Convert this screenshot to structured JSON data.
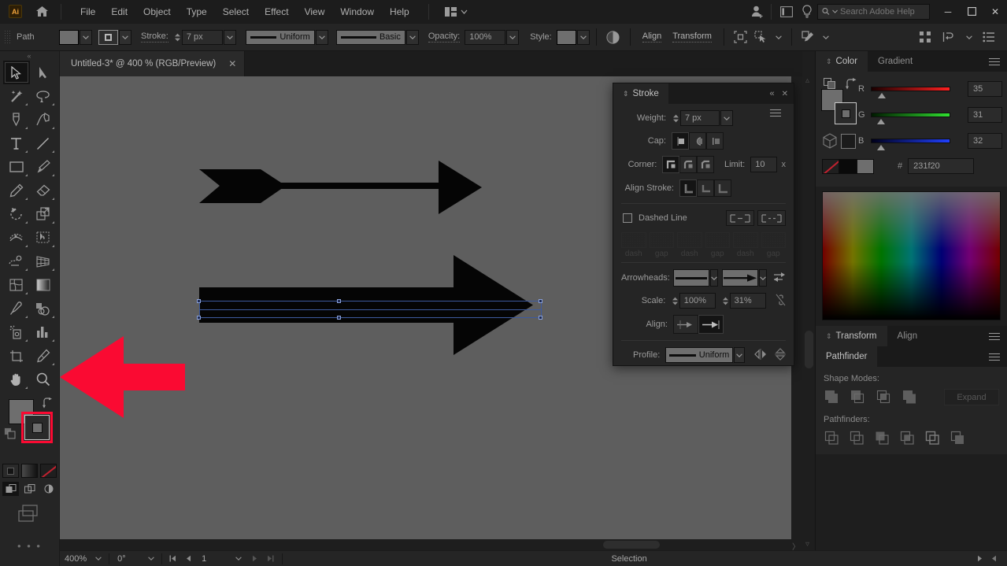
{
  "app": {
    "name": "Adobe Illustrator",
    "logo_text": "Ai",
    "home_icon": "home-icon"
  },
  "menubar": {
    "items": [
      "File",
      "Edit",
      "Object",
      "Type",
      "Select",
      "Effect",
      "View",
      "Window",
      "Help"
    ],
    "arrange_icon": "arrange-documents-icon",
    "account_icon": "account-add-icon",
    "workspace_icon": "workspace-switcher-icon",
    "tips_icon": "lightbulb-icon",
    "search": {
      "placeholder": "Search Adobe Help",
      "value": "",
      "icon": "search-icon"
    },
    "window_controls": {
      "minimize": "─",
      "maximize": "❐",
      "close": "✕"
    }
  },
  "controlbar": {
    "object_label": "Path",
    "fill_swatch": "#6e6e6e",
    "stroke_swatch_label": "stroke-swatch",
    "stroke_label": "Stroke:",
    "stroke_weight": "7 px",
    "profile_label": "Uniform",
    "brush_label": "Basic",
    "opacity_label": "Opacity:",
    "opacity_value": "100%",
    "style_label": "Style:",
    "align_label": "Align",
    "transform_label": "Transform",
    "icons": [
      "opacity-circle-icon",
      "isolate-selection-icon",
      "select-similar-icon",
      "edit-toolbar-icon",
      "arrange-icon",
      "recolor-icon",
      "document-setup-icon"
    ]
  },
  "document_tab": {
    "title": "Untitled-3* @ 400 % (RGB/Preview)",
    "close": "✕"
  },
  "toolbar": {
    "grip": "«",
    "tools": [
      {
        "name": "selection-tool",
        "active": true
      },
      {
        "name": "direct-selection-tool",
        "active": false
      },
      {
        "name": "magic-wand-tool",
        "active": false
      },
      {
        "name": "lasso-tool",
        "active": false
      },
      {
        "name": "pen-tool",
        "active": false
      },
      {
        "name": "curvature-tool",
        "active": false
      },
      {
        "name": "type-tool",
        "active": false
      },
      {
        "name": "line-segment-tool",
        "active": false
      },
      {
        "name": "rectangle-tool",
        "active": false
      },
      {
        "name": "paintbrush-tool",
        "active": false
      },
      {
        "name": "pencil-tool",
        "active": false
      },
      {
        "name": "eraser-tool",
        "active": false
      },
      {
        "name": "rotate-tool",
        "active": false
      },
      {
        "name": "scale-tool",
        "active": false
      },
      {
        "name": "width-tool",
        "active": false
      },
      {
        "name": "free-transform-tool",
        "active": false
      },
      {
        "name": "shape-builder-tool",
        "active": false
      },
      {
        "name": "perspective-grid-tool",
        "active": false
      },
      {
        "name": "mesh-tool",
        "active": false
      },
      {
        "name": "gradient-tool",
        "active": false
      },
      {
        "name": "eyedropper-tool",
        "active": false
      },
      {
        "name": "blend-tool",
        "active": false
      },
      {
        "name": "symbol-sprayer-tool",
        "active": false
      },
      {
        "name": "column-graph-tool",
        "active": false
      },
      {
        "name": "artboard-tool",
        "active": false
      },
      {
        "name": "slice-tool",
        "active": false
      },
      {
        "name": "hand-tool",
        "active": false
      },
      {
        "name": "zoom-tool",
        "active": false
      }
    ],
    "fill_color": "#6e6e6e",
    "stroke_color": "#6e6e6e",
    "highlight_color": "#fa0a32",
    "draw_modes": [
      "draw-normal-icon",
      "draw-behind-icon",
      "draw-inside-icon"
    ],
    "screen_modes": [
      "color-fill-icon",
      "gradient-fill-icon",
      "none-fill-icon"
    ],
    "more_dots": "• • •"
  },
  "stroke_panel": {
    "title": "Stroke",
    "collapse_icon": "⇕",
    "menu_icon": "panel-menu-icon",
    "collapse_btn": "«",
    "close_btn": "✕",
    "weight_label": "Weight:",
    "weight_value": "7 px",
    "cap_label": "Cap:",
    "cap_options": [
      "butt-cap",
      "round-cap",
      "projecting-cap"
    ],
    "cap_selected": 0,
    "corner_label": "Corner:",
    "corner_options": [
      "miter-join",
      "round-join",
      "bevel-join"
    ],
    "corner_selected": 0,
    "limit_label": "Limit:",
    "limit_value": "10",
    "limit_unit": "x",
    "align_stroke_label": "Align Stroke:",
    "align_stroke_options": [
      "align-center",
      "align-inside",
      "align-outside"
    ],
    "align_stroke_selected": 0,
    "dashed_line_label": "Dashed Line",
    "dashed_checked": false,
    "dash_labels": [
      "dash",
      "gap",
      "dash",
      "gap",
      "dash",
      "gap"
    ],
    "dash_values": [
      "",
      "",
      "",
      "",
      "",
      ""
    ],
    "arrowheads_label": "Arrowheads:",
    "arrowhead_start": "none",
    "arrowhead_end": "arrow",
    "swap_icon": "swap-arrowheads-icon",
    "scale_label": "Scale:",
    "scale_start": "100%",
    "scale_end": "31%",
    "link_icon": "link-broken-icon",
    "align_label": "Align:",
    "align_options": [
      "extend-beyond-end",
      "place-at-end"
    ],
    "align_selected": 1,
    "profile_label": "Profile:",
    "profile_value": "Uniform",
    "flip_across_icon": "flip-across-icon",
    "flip_along_icon": "flip-along-icon"
  },
  "color_panel": {
    "tabs": [
      {
        "label": "Color",
        "active": true
      },
      {
        "label": "Gradient",
        "active": false
      }
    ],
    "channels": [
      {
        "label": "R",
        "value": "35"
      },
      {
        "label": "G",
        "value": "31"
      },
      {
        "label": "B",
        "value": "32"
      }
    ],
    "hex_symbol": "#",
    "hex_value": "231f20",
    "swatches": [
      "none-swatch",
      "black-swatch",
      "gray-swatch"
    ],
    "menu_icon": "panel-menu-icon"
  },
  "transform_panel": {
    "tabs": [
      {
        "label": "Transform",
        "active": true
      },
      {
        "label": "Align",
        "active": false
      }
    ],
    "menu_icon": "panel-menu-icon"
  },
  "pathfinder_panel": {
    "tabs": [
      {
        "label": "Pathfinder",
        "active": true
      }
    ],
    "shape_modes_label": "Shape Modes:",
    "shape_modes": [
      "unite-icon",
      "minus-front-icon",
      "intersect-icon",
      "exclude-icon"
    ],
    "expand_label": "Expand",
    "pathfinders_label": "Pathfinders:",
    "pathfinders": [
      "divide-icon",
      "trim-icon",
      "merge-icon",
      "crop-icon",
      "outline-icon",
      "minus-back-icon"
    ],
    "menu_icon": "panel-menu-icon"
  },
  "statusbar": {
    "zoom": "400%",
    "rotation": "0°",
    "artboard": "1",
    "tool_status": "Selection",
    "first_icon": "first-artboard-icon",
    "prev_icon": "prev-artboard-icon",
    "next_icon": "next-artboard-icon",
    "last_icon": "last-artboard-icon"
  },
  "canvas": {
    "background": "#5e5e5e",
    "artwork_color": "#050505",
    "annotation_arrow_color": "#fa0a32",
    "selection_color": "#3d5a9e",
    "objects": [
      {
        "name": "arrow-thin-feathered",
        "description": "thin horizontal arrow with feathered tail and arrowhead"
      },
      {
        "name": "arrow-thick-selected",
        "description": "thick horizontal arrow with large arrowhead, selected"
      }
    ]
  }
}
